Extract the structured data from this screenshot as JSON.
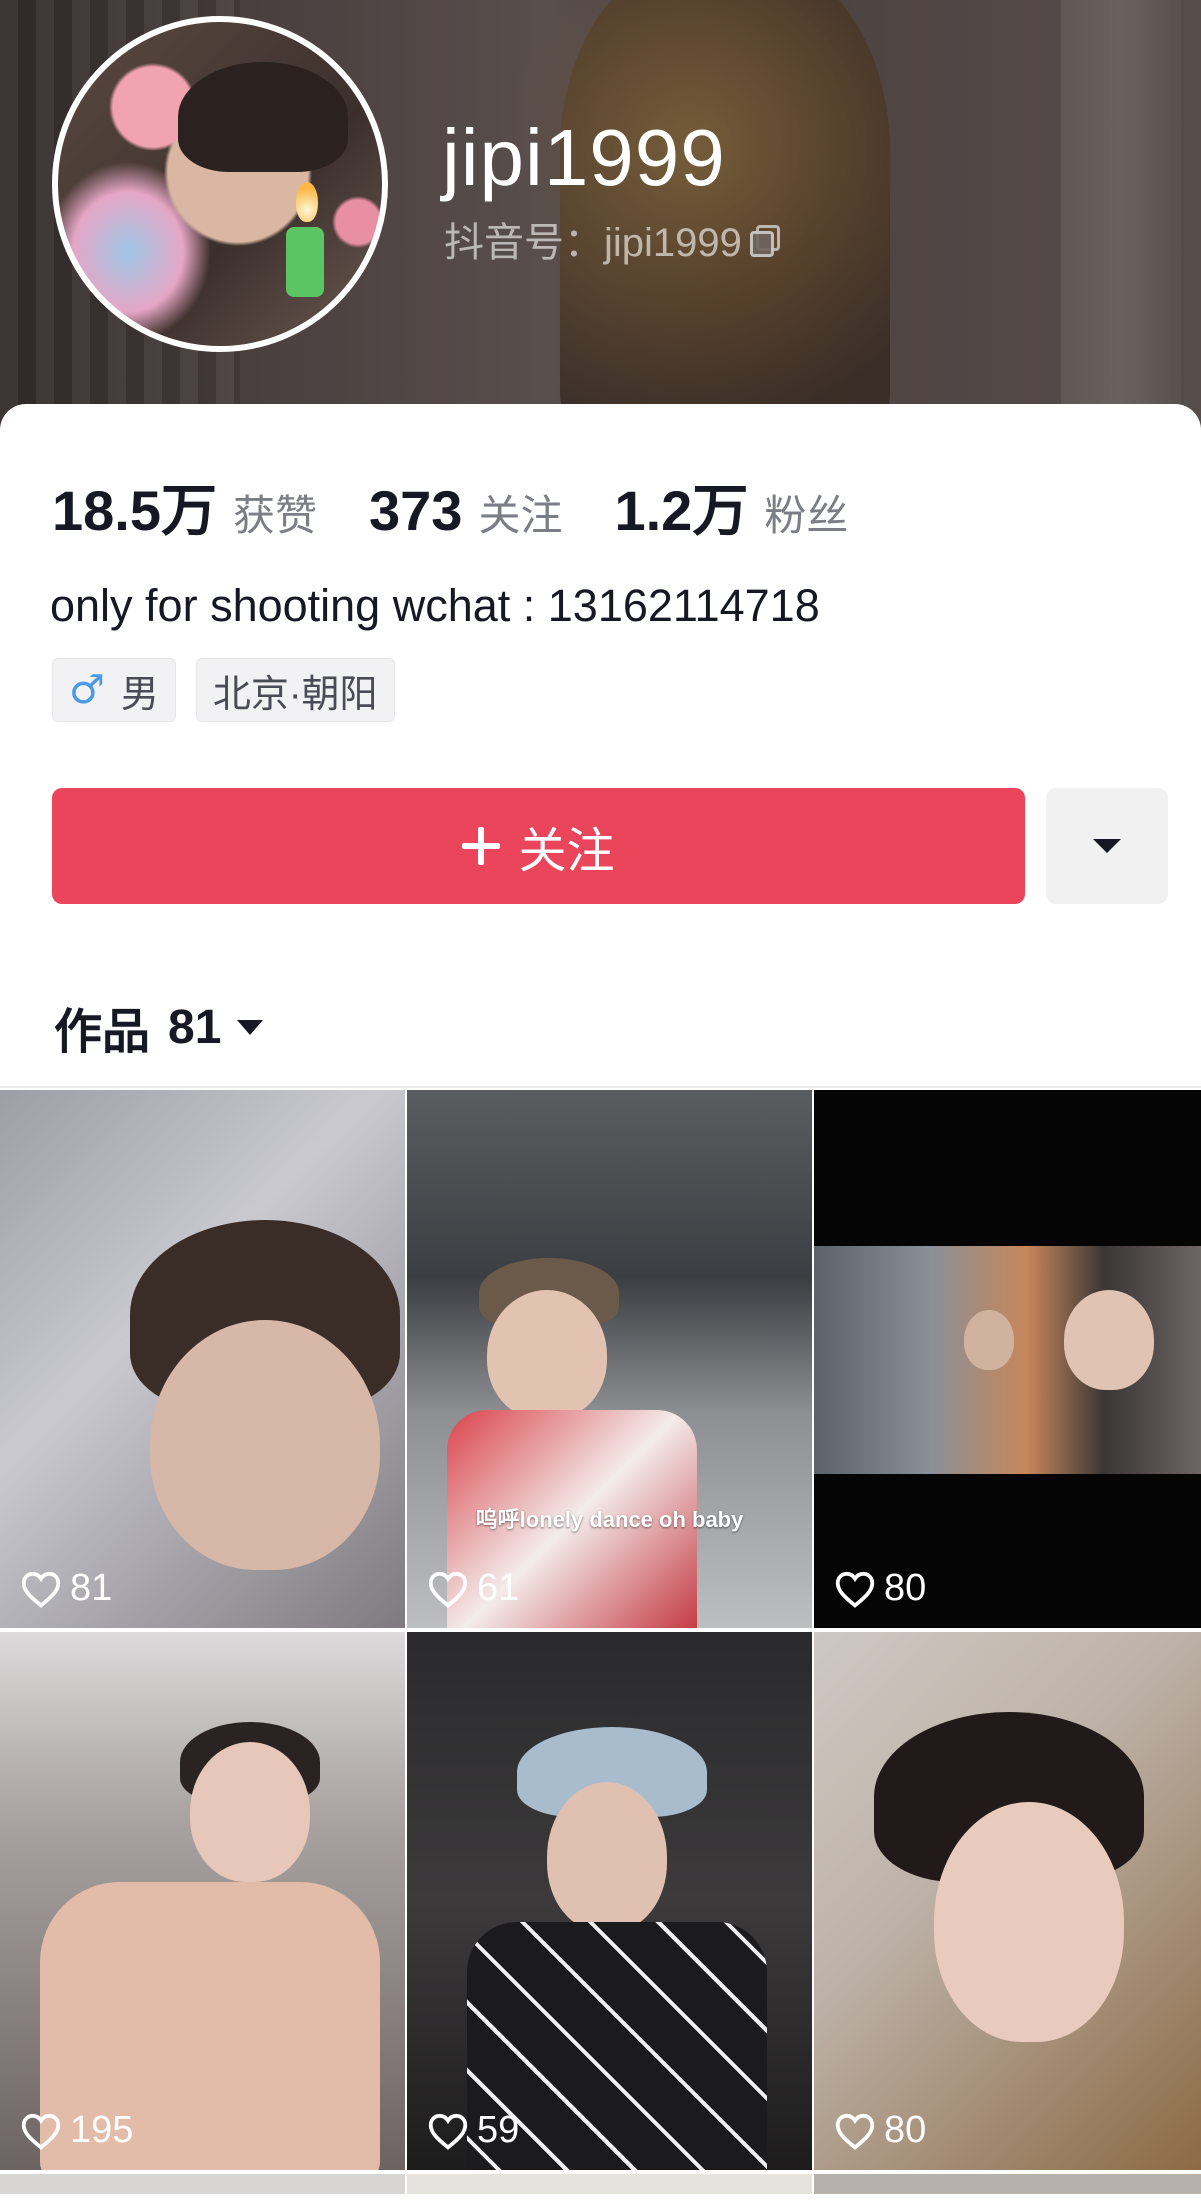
{
  "profile": {
    "username": "jipi1999",
    "douyin_id": "抖音号：jipi1999"
  },
  "stats": [
    {
      "value": "18.5万",
      "label": "获赞"
    },
    {
      "value": "373",
      "label": "关注"
    },
    {
      "value": "1.2万",
      "label": "粉丝"
    }
  ],
  "bio": "only for shooting wchat : 13162114718",
  "tags": {
    "gender": "男",
    "location": "北京·朝阳"
  },
  "actions": {
    "follow_label": "关注"
  },
  "works": {
    "label": "作品",
    "count": "81"
  },
  "videos": [
    {
      "likes": "81",
      "caption": ""
    },
    {
      "likes": "61",
      "caption": "呜呼lonely dance oh baby"
    },
    {
      "likes": "80",
      "caption": ""
    },
    {
      "likes": "195",
      "caption": ""
    },
    {
      "likes": "59",
      "caption": ""
    },
    {
      "likes": "80",
      "caption": ""
    }
  ],
  "colors": {
    "follow_button": "#ea455a",
    "male_icon": "#4a9ae6"
  }
}
